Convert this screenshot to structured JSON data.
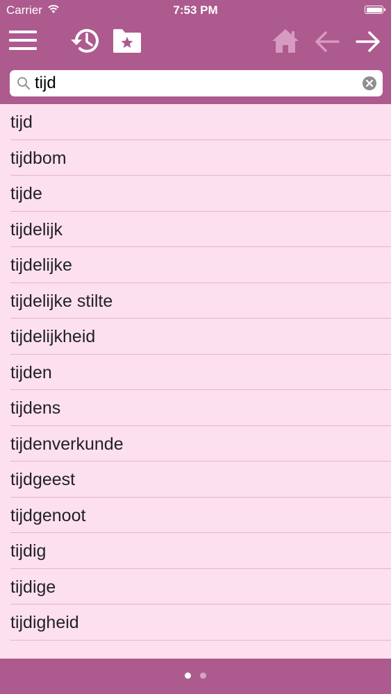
{
  "status_bar": {
    "carrier": "Carrier",
    "time": "7:53 PM"
  },
  "toolbar": {
    "icons": [
      "menu-icon",
      "history-icon",
      "favorites-folder-icon",
      "home-icon",
      "back-arrow-icon",
      "forward-arrow-icon"
    ],
    "disabled_icons": [
      "home-icon",
      "back-arrow-icon"
    ]
  },
  "search": {
    "value": "tijd"
  },
  "results": [
    "tijd",
    "tijdbom",
    "tijde",
    "tijdelijk",
    "tijdelijke",
    "tijdelijke stilte",
    "tijdelijkheid",
    "tijden",
    "tijdens",
    "tijdenverkunde",
    "tijdgeest",
    "tijdgenoot",
    "tijdig",
    "tijdige",
    "tijdigheid"
  ],
  "pager": {
    "pages": 2,
    "current": 1
  },
  "colors": {
    "bar": "#ad5a8e",
    "list_background": "#fde0ef",
    "divider": "#e2b3cc",
    "disabled_icon": "#d79ac0"
  }
}
